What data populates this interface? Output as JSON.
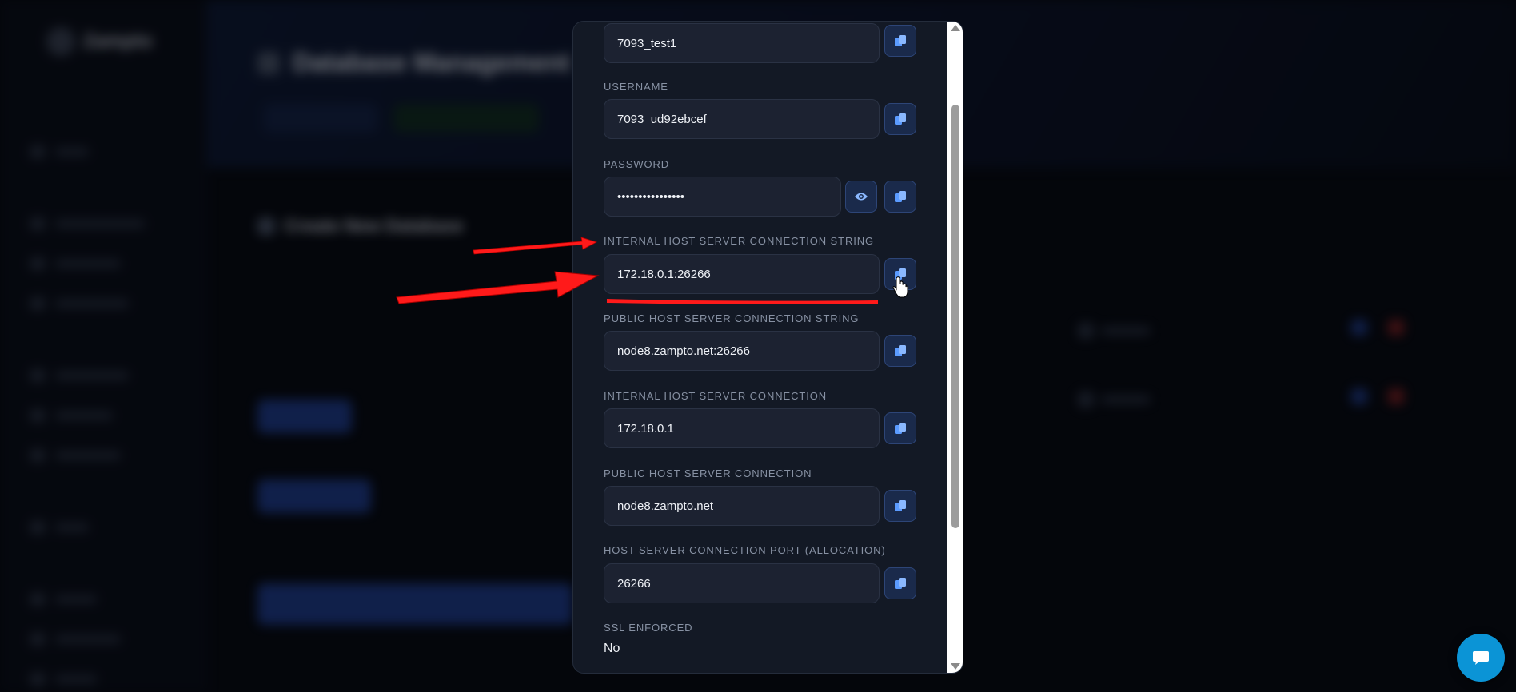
{
  "background": {
    "brand": "Zampto",
    "page_title": "Database Management",
    "card_title": "Create New Database"
  },
  "modal": {
    "fields": [
      {
        "key": "database",
        "label": "",
        "value": "7093_test1",
        "actions": [
          "copy"
        ]
      },
      {
        "key": "username",
        "label": "USERNAME",
        "value": "7093_ud92ebcef",
        "actions": [
          "copy"
        ]
      },
      {
        "key": "password",
        "label": "PASSWORD",
        "value": "••••••••••••••••",
        "actions": [
          "show",
          "copy"
        ]
      },
      {
        "key": "internal_conn_string",
        "label": "INTERNAL HOST SERVER CONNECTION STRING",
        "value": "172.18.0.1:26266",
        "actions": [
          "copy"
        ]
      },
      {
        "key": "public_conn_string",
        "label": "PUBLIC HOST SERVER CONNECTION STRING",
        "value": "node8.zampto.net:26266",
        "actions": [
          "copy"
        ]
      },
      {
        "key": "internal_conn",
        "label": "INTERNAL HOST SERVER CONNECTION",
        "value": "172.18.0.1",
        "actions": [
          "copy"
        ]
      },
      {
        "key": "public_conn",
        "label": "PUBLIC HOST SERVER CONNECTION",
        "value": "node8.zampto.net",
        "actions": [
          "copy"
        ]
      },
      {
        "key": "port",
        "label": "HOST SERVER CONNECTION PORT (ALLOCATION)",
        "value": "26266",
        "actions": [
          "copy"
        ]
      }
    ],
    "ssl": {
      "label": "SSL ENFORCED",
      "value": "No"
    }
  },
  "icons": {
    "copy": "copy-icon",
    "show": "eye-icon",
    "chat": "chat-bubble-icon",
    "annotation_arrow": "red-arrow-annotation"
  },
  "colors": {
    "accent": "#3b82f6",
    "annotation": "#ff1a1a",
    "chat": "#0b94d6"
  }
}
